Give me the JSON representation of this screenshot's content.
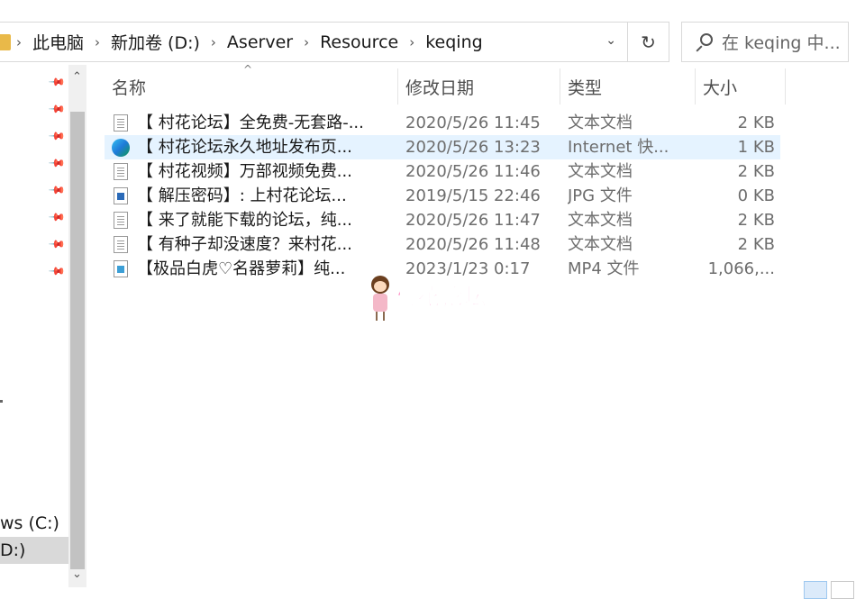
{
  "address": {
    "crumbs": [
      "此电脑",
      "新加卷 (D:)",
      "Aserver",
      "Resource",
      "keqing"
    ],
    "separator": "›",
    "dropdown_glyph": "⌄",
    "refresh_glyph": "↻"
  },
  "search": {
    "placeholder": "在 keqing 中..."
  },
  "nav": {
    "drives": [
      "ws (C:)",
      "D:)"
    ],
    "scroll_up": "⌃",
    "scroll_down": "⌄",
    "pin_glyph": "📌"
  },
  "columns": {
    "name": "名称",
    "date": "修改日期",
    "type": "类型",
    "size": "大小",
    "sort_arrow": "^"
  },
  "files": [
    {
      "icon": "text-file-icon",
      "name": "【 村花论坛】全免费-无套路-...",
      "date": "2020/5/26 11:45",
      "type": "文本文档",
      "size": "2 KB"
    },
    {
      "icon": "edge-url-icon",
      "name": "【 村花论坛永久地址发布页...",
      "date": "2020/5/26 13:23",
      "type": "Internet 快...",
      "size": "1 KB"
    },
    {
      "icon": "text-file-icon",
      "name": "【 村花视频】万部视频免费...",
      "date": "2020/5/26 11:46",
      "type": "文本文档",
      "size": "2 KB"
    },
    {
      "icon": "jpg-file-icon",
      "name": "【 解压密码】: 上村花论坛...",
      "date": "2019/5/15 22:46",
      "type": "JPG 文件",
      "size": "0 KB"
    },
    {
      "icon": "text-file-icon",
      "name": "【 来了就能下载的论坛，纯...",
      "date": "2020/5/26 11:47",
      "type": "文本文档",
      "size": "2 KB"
    },
    {
      "icon": "text-file-icon",
      "name": "【 有种子却没速度？来村花...",
      "date": "2020/5/26 11:48",
      "type": "文本文档",
      "size": "2 KB"
    },
    {
      "icon": "mp4-file-icon",
      "name": "【极品白虎♡名器萝莉】纯...",
      "date": "2023/1/23 0:17",
      "type": "MP4 文件",
      "size": "1,066,..."
    }
  ],
  "watermark": {
    "text": "村花论坛"
  },
  "colors": {
    "selection": "#e5f3ff",
    "watermark": "#ff4fa3",
    "nav_selected": "#d9d9d9"
  }
}
